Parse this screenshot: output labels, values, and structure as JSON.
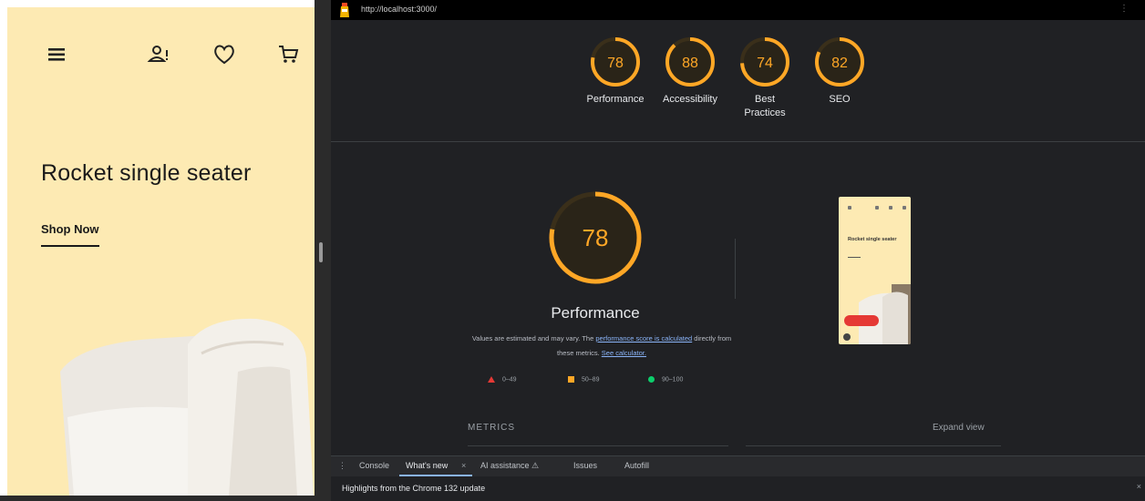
{
  "site": {
    "hero_title": "Rocket single seater",
    "shop_now": "Shop Now",
    "icons": [
      "menu-icon",
      "user-icon",
      "heart-icon",
      "cart-icon"
    ],
    "background": "#fdeab3"
  },
  "devtools": {
    "url": "http://localhost:3000/",
    "scores": [
      {
        "name": "Performance",
        "value": "78"
      },
      {
        "name": "Accessibility",
        "value": "88"
      },
      {
        "name": "Best Practices",
        "value": "74"
      },
      {
        "name": "SEO",
        "value": "82"
      }
    ],
    "performance": {
      "score": "78",
      "title": "Performance",
      "desc_part1": "Values are estimated and may vary. The ",
      "desc_link1": "performance score is calculated",
      "desc_part2": " directly from these metrics. ",
      "desc_link2": "See calculator."
    },
    "legend": {
      "fail": "0–49",
      "average": "50–89",
      "pass": "90–100"
    },
    "thumbnail": {
      "title": "Rocket single seater"
    },
    "metrics_label": "METRICS",
    "expand_view": "Expand view",
    "drawer": {
      "tabs": [
        "Console",
        "What's new",
        "AI assistance",
        "Issues",
        "Autofill"
      ],
      "highlights": "Highlights from the Chrome 132 update"
    },
    "colors": {
      "average": "#ffa726",
      "fail": "#e53935",
      "pass": "#0cce6b",
      "panel_bg": "#202124"
    }
  }
}
